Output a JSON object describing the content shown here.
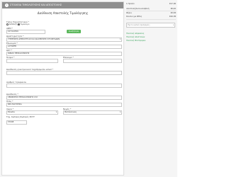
{
  "main": {
    "step_number": "1",
    "header_text": "ΣΤΟΙΧΕΙΑ ΤΙΜΟΛΟΓΗΣΗΣ ΚΑΙ ΑΠΟΣΤΟΛΗΣ",
    "section_title": "Διεύθυνση Αποστολής Τιμολόγησης",
    "doc_type": {
      "label": "Τύπος Παραστατικού *",
      "options": [
        {
          "label": "Απόδειξη",
          "selected": false
        },
        {
          "label": "Τιμολόγιο",
          "selected": true
        }
      ]
    },
    "afm": {
      "label": "ΑΦΜ *",
      "value": "107414556"
    },
    "search_button": "Αναζήτηση ΑΦΜ",
    "activity": {
      "label": "Δραστηριότητα *",
      "value": "ΥΠΗΡΕΣΙΕΣ ΔΗΜΙΟΥΡΓΙΑΣ ΚΑΙ ΔΙΑΧΕΙΡΙΣΗΣ ΙΣΤΟΣΕΛΙΔΩΝ"
    },
    "company": {
      "label": "Επωνυμία *",
      "value": "ACTIWEB"
    },
    "doy": {
      "label": "ΔΟΥ *",
      "value": "ΙΩΝΙΑΣ ΘΕΣΣΑΛΟΝΙΚΗΣ"
    },
    "first_name": {
      "label": "Όνομα *",
      "value": ""
    },
    "last_name": {
      "label": "Επώνυμο *",
      "value": ""
    },
    "email": {
      "label": "Διεύθυνση ηλεκτρονικού ταχυδρομείου email *",
      "value": ""
    },
    "phone": {
      "label": "Αριθμός τηλεφώνου",
      "value": ""
    },
    "address": {
      "label": "Διεύθυνση *",
      "value": "ΛΕΩΦΟΡΟΣ ΘΕΣΣΑΛΟΝΙΚΗΣ 132"
    },
    "city": {
      "label": "Πόλη *",
      "value": "ΝΕΑ ΜΑΓΝΗΣΙΑ"
    },
    "country": {
      "label": "Χώρα *",
      "value": "Ελλάδα"
    },
    "region": {
      "label": "Νομός *",
      "value": "Θεσσαλονίκη"
    },
    "postcode": {
      "label": "Ταχ. Κώδικας/Κωδικός ΡΟΥΤ",
      "value": "57008"
    }
  },
  "sidebar": {
    "rows": [
      {
        "label": "1 Προϊόν",
        "value": "€17,00"
      },
      {
        "label": "Αποστολή/Αντικαταβολή",
        "value": "€0,00"
      },
      {
        "label": "Φόροι",
        "value": "€3,58"
      },
      {
        "label": "Σύνολο (με ΦΠΑ)",
        "value": "€20,58"
      }
    ],
    "coupon_placeholder": "Έχετε κωδικό προσφοράς;",
    "links": [
      "Πολιτική Ασφαλείας",
      "Πολιτική Αποστολών",
      "Πολιτική Επιστροφών"
    ]
  },
  "colors": {
    "header_bg": "#8e8e8e",
    "button_green": "#5cb85c",
    "link_green": "#2e9e53"
  }
}
